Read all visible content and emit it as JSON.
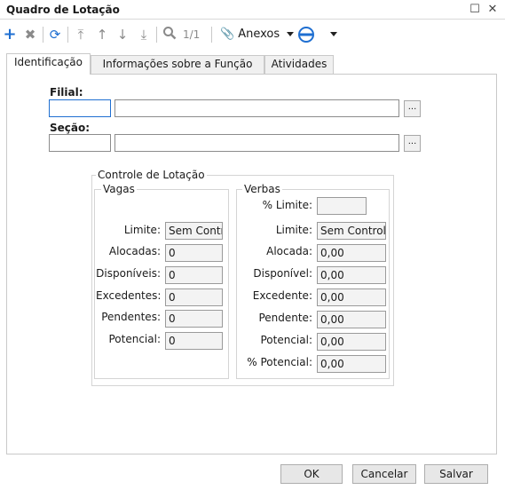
{
  "window": {
    "title": "Quadro de Lotação",
    "restore_glyph": "☐",
    "close_glyph": "✕"
  },
  "toolbar": {
    "icons": [
      "plus-icon",
      "delete-icon",
      "refresh-icon",
      "first-record-icon",
      "previous-record-icon",
      "next-record-icon",
      "last-record-icon",
      "search-icon"
    ],
    "page_count": "1/1",
    "anexos_label": "Anexos"
  },
  "tabs": [
    {
      "label": "Identificação",
      "active": true
    },
    {
      "label": "Informações sobre a Função",
      "active": false
    },
    {
      "label": "Atividades",
      "active": false
    }
  ],
  "form": {
    "filial_label": "Filial:",
    "secao_label": "Seção:",
    "lookup_button": "..."
  },
  "controle": {
    "title": "Controle de Lotação",
    "vagas": {
      "title": "Vagas",
      "fields": [
        {
          "label": "Limite:",
          "value": "Sem Controle"
        },
        {
          "label": "Alocadas:",
          "value": "0"
        },
        {
          "label": "Disponíveis:",
          "value": "0"
        },
        {
          "label": "Excedentes:",
          "value": "0"
        },
        {
          "label": "Pendentes:",
          "value": "0"
        },
        {
          "label": "Potencial:",
          "value": "0"
        }
      ]
    },
    "verbas": {
      "title": "Verbas",
      "fields": [
        {
          "label": "% Limite:",
          "value": ""
        },
        {
          "label": "Limite:",
          "value": "Sem Controle"
        },
        {
          "label": "Alocada:",
          "value": "0,00"
        },
        {
          "label": "Disponível:",
          "value": "0,00"
        },
        {
          "label": "Excedente:",
          "value": "0,00"
        },
        {
          "label": "Pendente:",
          "value": "0,00"
        },
        {
          "label": "Potencial:",
          "value": "0,00"
        },
        {
          "label": "% Potencial:",
          "value": "0,00"
        }
      ]
    }
  },
  "buttons": {
    "ok": "OK",
    "cancel": "Cancelar",
    "save": "Salvar"
  }
}
